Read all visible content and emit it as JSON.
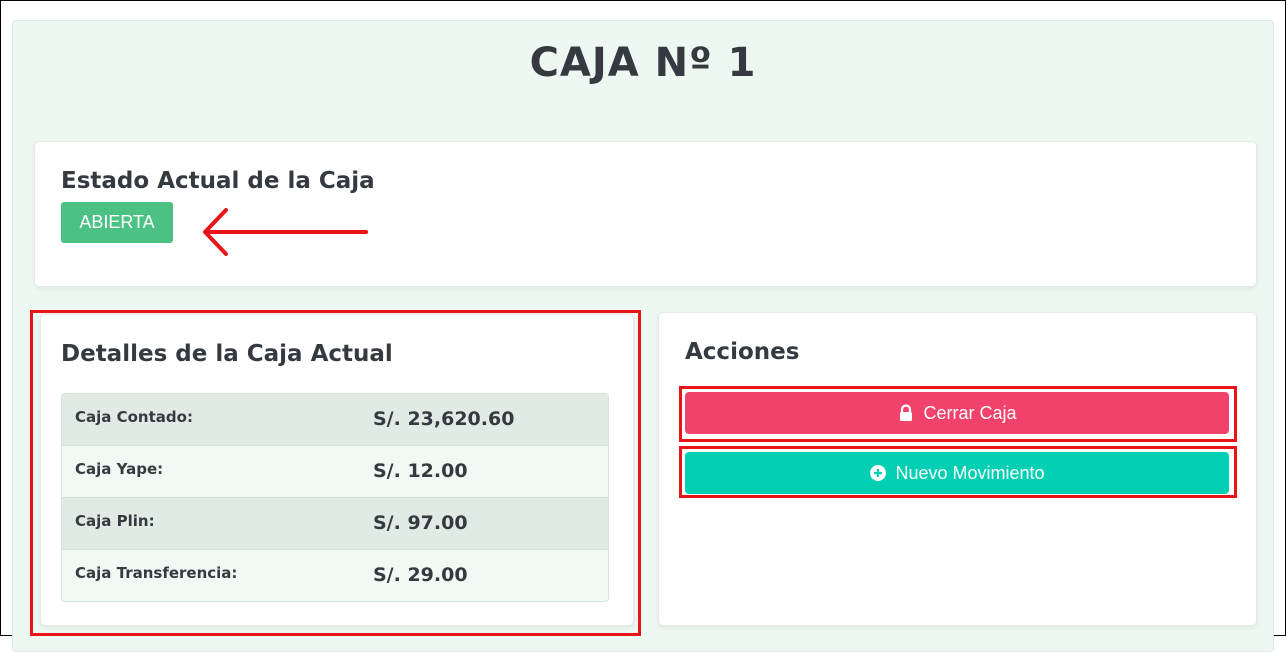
{
  "page": {
    "title": "CAJA Nº 1"
  },
  "status_card": {
    "heading": "Estado Actual de la Caja",
    "status_badge": "ABIERTA"
  },
  "details_card": {
    "heading": "Detalles de la Caja Actual",
    "rows": [
      {
        "label": "Caja Contado:",
        "value": "S/. 23,620.60"
      },
      {
        "label": "Caja Yape:",
        "value": "S/. 12.00"
      },
      {
        "label": "Caja Plin:",
        "value": "S/. 97.00"
      },
      {
        "label": "Caja Transferencia:",
        "value": "S/. 29.00"
      }
    ]
  },
  "actions_card": {
    "heading": "Acciones",
    "buttons": {
      "cerrar": {
        "label": "Cerrar Caja",
        "icon": "lock-icon"
      },
      "nuevo": {
        "label": "Nuevo Movimiento",
        "icon": "plus-circle-icon"
      }
    }
  },
  "colors": {
    "status_open": "#4cc184",
    "danger": "#f0426a",
    "teal": "#00cfb4",
    "annotation_red": "#e8141a"
  }
}
